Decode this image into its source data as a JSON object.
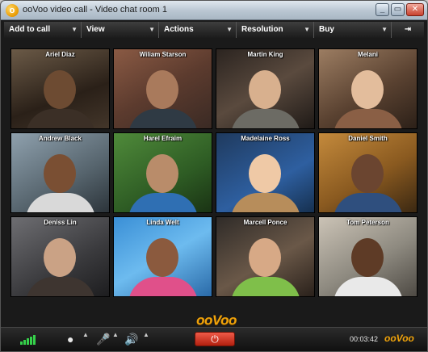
{
  "window": {
    "title": "ooVoo video call - Video chat room 1",
    "logo_letter": "o",
    "controls": {
      "minimize": "_",
      "maximize": "▭",
      "close": "✕"
    }
  },
  "menu": [
    {
      "label": "Add to call"
    },
    {
      "label": "View"
    },
    {
      "label": "Actions"
    },
    {
      "label": "Resolution"
    },
    {
      "label": "Buy"
    }
  ],
  "menu_pin": "⇥",
  "participants": [
    {
      "name": "Ariel Diaz"
    },
    {
      "name": "Wiliam Starson"
    },
    {
      "name": "Martin King"
    },
    {
      "name": "Melani"
    },
    {
      "name": "Andrew Black"
    },
    {
      "name": "Harel Efraim"
    },
    {
      "name": "Madelaine Ross"
    },
    {
      "name": "Daniel Smith"
    },
    {
      "name": "Deniss Lin"
    },
    {
      "name": "Linda Welt"
    },
    {
      "name": "Marcell Ponce"
    },
    {
      "name": "Tom Peterson"
    }
  ],
  "brand": "ooVoo",
  "bottom": {
    "timer": "00:03:42",
    "brand": "ooVoo",
    "end_call_icon": "⏻",
    "camera_icon": "●",
    "mic_icon": "🎤",
    "speaker_icon": "🔊",
    "caret": "▲"
  },
  "colors": {
    "accent": "#f0a30a",
    "end_call": "#c8321e",
    "signal": "#35d14a"
  }
}
